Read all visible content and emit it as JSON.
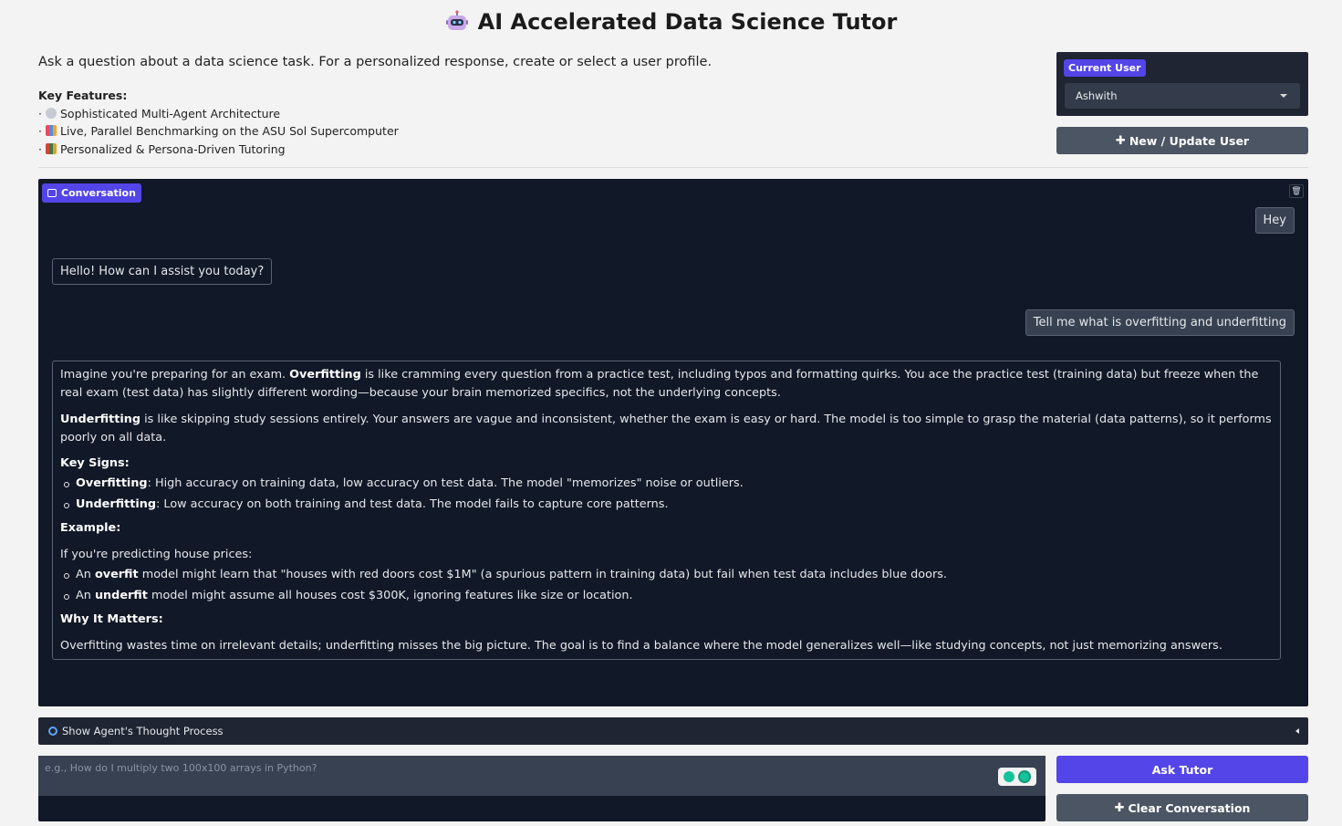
{
  "header": {
    "title": "AI Accelerated Data Science Tutor",
    "intro": "Ask a question about a data science task. For a personalized response, create or select a user profile.",
    "features_heading": "Key Features:",
    "features": [
      "Sophisticated Multi-Agent Architecture",
      "Live, Parallel Benchmarking on the ASU Sol Supercomputer",
      "Personalized & Persona-Driven Tutoring"
    ]
  },
  "user_panel": {
    "badge": "Current User",
    "selected_user": "Ashwith",
    "new_update_label": "New / Update User"
  },
  "conversation": {
    "badge": "Conversation",
    "messages": {
      "m1": "Hey",
      "m2": "Hello! How can I assist you today?",
      "m3": "Tell me what is overfitting and underfitting"
    },
    "answer": {
      "p1_pre": "Imagine you're preparing for an exam. ",
      "p1_bold": "Overfitting",
      "p1_post": " is like cramming every question from a practice test, including typos and formatting quirks. You ace the practice test (training data) but freeze when the real exam (test data) has slightly different wording—because your brain memorized specifics, not the underlying concepts.",
      "p2_bold": "Underfitting",
      "p2_post": " is like skipping study sessions entirely. Your answers are vague and inconsistent, whether the exam is easy or hard. The model is too simple to grasp the material (data patterns), so it performs poorly on all data.",
      "key_signs": "Key Signs:",
      "ks1_bold": "Overfitting",
      "ks1_post": ": High accuracy on training data, low accuracy on test data. The model \"memorizes\" noise or outliers.",
      "ks2_bold": "Underfitting",
      "ks2_post": ": Low accuracy on both training and test data. The model fails to capture core patterns.",
      "example": "Example:",
      "example_intro": "If you're predicting house prices:",
      "ex1_pre": "An ",
      "ex1_bold": "overfit",
      "ex1_post": " model might learn that \"houses with red doors cost $1M\" (a spurious pattern in training data) but fail when test data includes blue doors.",
      "ex2_pre": "An ",
      "ex2_bold": "underfit",
      "ex2_post": " model might assume all houses cost $300K, ignoring features like size or location.",
      "why": "Why It Matters:",
      "why_text": "Overfitting wastes time on irrelevant details; underfitting misses the big picture. The goal is to find a balance where the model generalizes well—like studying concepts, not just memorizing answers."
    }
  },
  "thought_process": {
    "label": "Show Agent's Thought Process"
  },
  "input": {
    "placeholder": "e.g., How do I multiply two 100x100 arrays in Python?"
  },
  "actions": {
    "ask_label": "Ask Tutor",
    "clear_label": "Clear Conversation"
  },
  "colors": {
    "accent": "#5345e8",
    "panel_dark": "#111827",
    "button_gray": "#4b5563"
  }
}
